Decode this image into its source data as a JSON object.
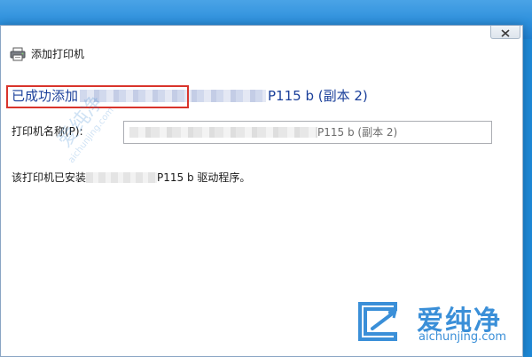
{
  "window": {
    "title": "添加打印机",
    "title_icon": "printer-icon",
    "close_icon": "close-icon"
  },
  "heading": {
    "prefix": "已成功添加",
    "suffix": "P115 b (副本 2)"
  },
  "printer_name": {
    "label": "打印机名称(P):",
    "value_suffix": "P115 b (副本 2)"
  },
  "info": {
    "prefix": "该打印机已安装",
    "suffix": "P115 b 驱动程序。"
  },
  "watermark": {
    "cn": "爱纯净",
    "en": "aichunjing.com"
  },
  "colors": {
    "heading": "#1a3f9a",
    "highlight": "#d9342b",
    "desktop": "#1e88d6",
    "watermark": "#3a8fd8"
  }
}
